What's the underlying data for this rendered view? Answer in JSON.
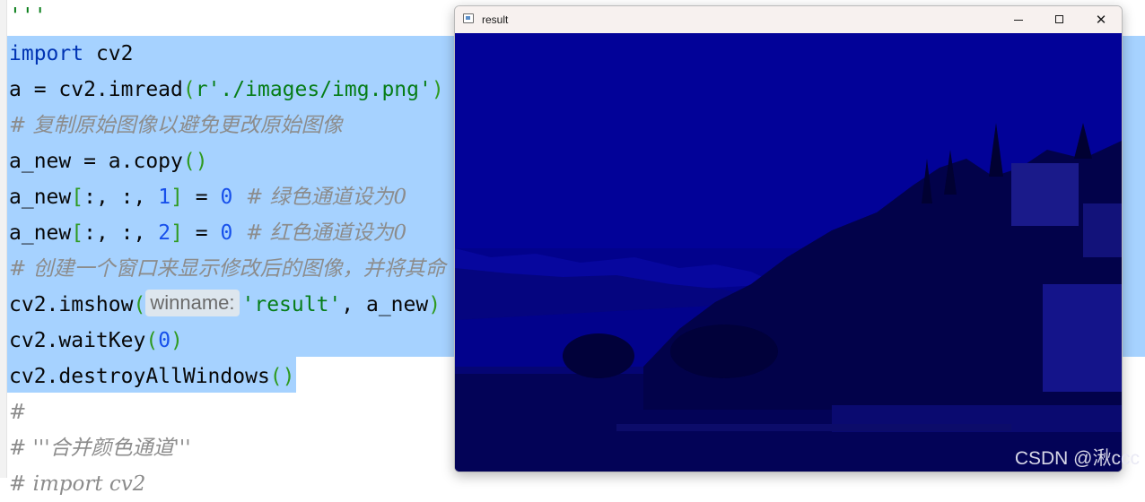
{
  "editor": {
    "lines": {
      "l0": "'''",
      "l1_kw": "import",
      "l1_rest": " cv2",
      "l2_a": "a = cv2.imread",
      "l2_p1": "(",
      "l2_s": "r'./images/img.png'",
      "l2_p2": ")",
      "l3": "# 复制原始图像以避免更改原始图像",
      "l4_a": "a_new = a.copy",
      "l4_p": "()",
      "l5_a": "a_new",
      "l5_b": "[",
      "l5_c": ":, :, ",
      "l5_n": "1",
      "l5_d": "]",
      "l5_e": " = ",
      "l5_z": "0",
      "l5_cm": "  # 绿色通道设为0",
      "l6_a": "a_new",
      "l6_b": "[",
      "l6_c": ":, :, ",
      "l6_n": "2",
      "l6_d": "]",
      "l6_e": " = ",
      "l6_z": "0",
      "l6_cm": "  # 红色通道设为0",
      "l7": "# 创建一个窗口来显示修改后的图像，并将其命",
      "l8_a": "cv2.imshow",
      "l8_p1": "(",
      "l8_hint": "winname:",
      "l8_s": "'result'",
      "l8_rest": ", a_new",
      "l8_p2": ")",
      "l9_a": "cv2.waitKey",
      "l9_p1": "(",
      "l9_n": "0",
      "l9_p2": ")",
      "l10_a": "cv2.destroyAllWindows",
      "l10_p": "()",
      "l11": "#",
      "l12": "# '''合并颜色通道'''",
      "l13": "# import cv2"
    }
  },
  "window": {
    "title": "result",
    "minimize_label": "minimize",
    "maximize_label": "maximize",
    "close_glyph": "✕"
  },
  "watermark": "CSDN @湫ccc",
  "colors": {
    "selection": "#a6d2ff",
    "keyword": "#0033b3",
    "string": "#067d17",
    "number": "#1750eb",
    "comment": "#8c8c8c",
    "image_tint": "#0303a8"
  }
}
